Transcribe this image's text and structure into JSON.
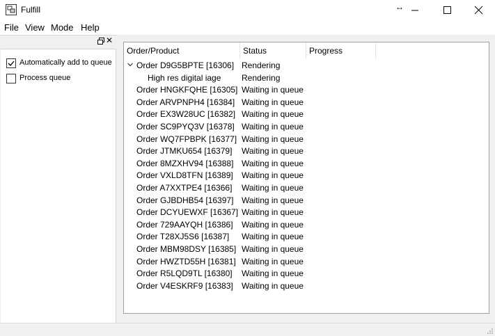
{
  "window": {
    "title": "Fulfill",
    "resize_glyph": "↔"
  },
  "menu": {
    "items": [
      "File",
      "View",
      "Mode",
      "Help"
    ]
  },
  "dock": {
    "float_icon": "float-icon",
    "close_glyph": "✕",
    "checkboxes": [
      {
        "label": "Automatically add to queue",
        "checked": true
      },
      {
        "label": "Process queue",
        "checked": false
      }
    ]
  },
  "tree": {
    "columns": [
      "Order/Product",
      "Status",
      "Progress"
    ],
    "rows": [
      {
        "text": "Order D9G5BPTE [16306]",
        "status": "Rendering",
        "level": 0,
        "expanded": true
      },
      {
        "text": "High res digital iage",
        "status": "Rendering",
        "level": 1
      },
      {
        "text": "Order HNGKFQHE [16305]",
        "status": "Waiting in queue",
        "level": 0
      },
      {
        "text": "Order ARVPNPH4 [16384]",
        "status": "Waiting in queue",
        "level": 0
      },
      {
        "text": "Order EX3W28UC [16382]",
        "status": "Waiting in queue",
        "level": 0
      },
      {
        "text": "Order SC9PYQ3V [16378]",
        "status": "Waiting in queue",
        "level": 0
      },
      {
        "text": "Order WQ7FPBPK [16377]",
        "status": "Waiting in queue",
        "level": 0
      },
      {
        "text": "Order JTMKU654 [16379]",
        "status": "Waiting in queue",
        "level": 0
      },
      {
        "text": "Order 8MZXHV94 [16388]",
        "status": "Waiting in queue",
        "level": 0
      },
      {
        "text": "Order VXLD8TFN [16389]",
        "status": "Waiting in queue",
        "level": 0
      },
      {
        "text": "Order A7XXTPE4 [16366]",
        "status": "Waiting in queue",
        "level": 0
      },
      {
        "text": "Order GJBDHB54 [16397]",
        "status": "Waiting in queue",
        "level": 0
      },
      {
        "text": "Order DCYUEWXF [16367]",
        "status": "Waiting in queue",
        "level": 0
      },
      {
        "text": "Order 729AAYQH [16386]",
        "status": "Waiting in queue",
        "level": 0
      },
      {
        "text": "Order T28XJ5S6 [16387]",
        "status": "Waiting in queue",
        "level": 0
      },
      {
        "text": "Order MBM98DSY [16385]",
        "status": "Waiting in queue",
        "level": 0
      },
      {
        "text": "Order HWZTD55H [16381]",
        "status": "Waiting in queue",
        "level": 0
      },
      {
        "text": "Order R5LQD9TL [16380]",
        "status": "Waiting in queue",
        "level": 0
      },
      {
        "text": "Order V4ESKRF9 [16383]",
        "status": "Waiting in queue",
        "level": 0
      }
    ]
  }
}
